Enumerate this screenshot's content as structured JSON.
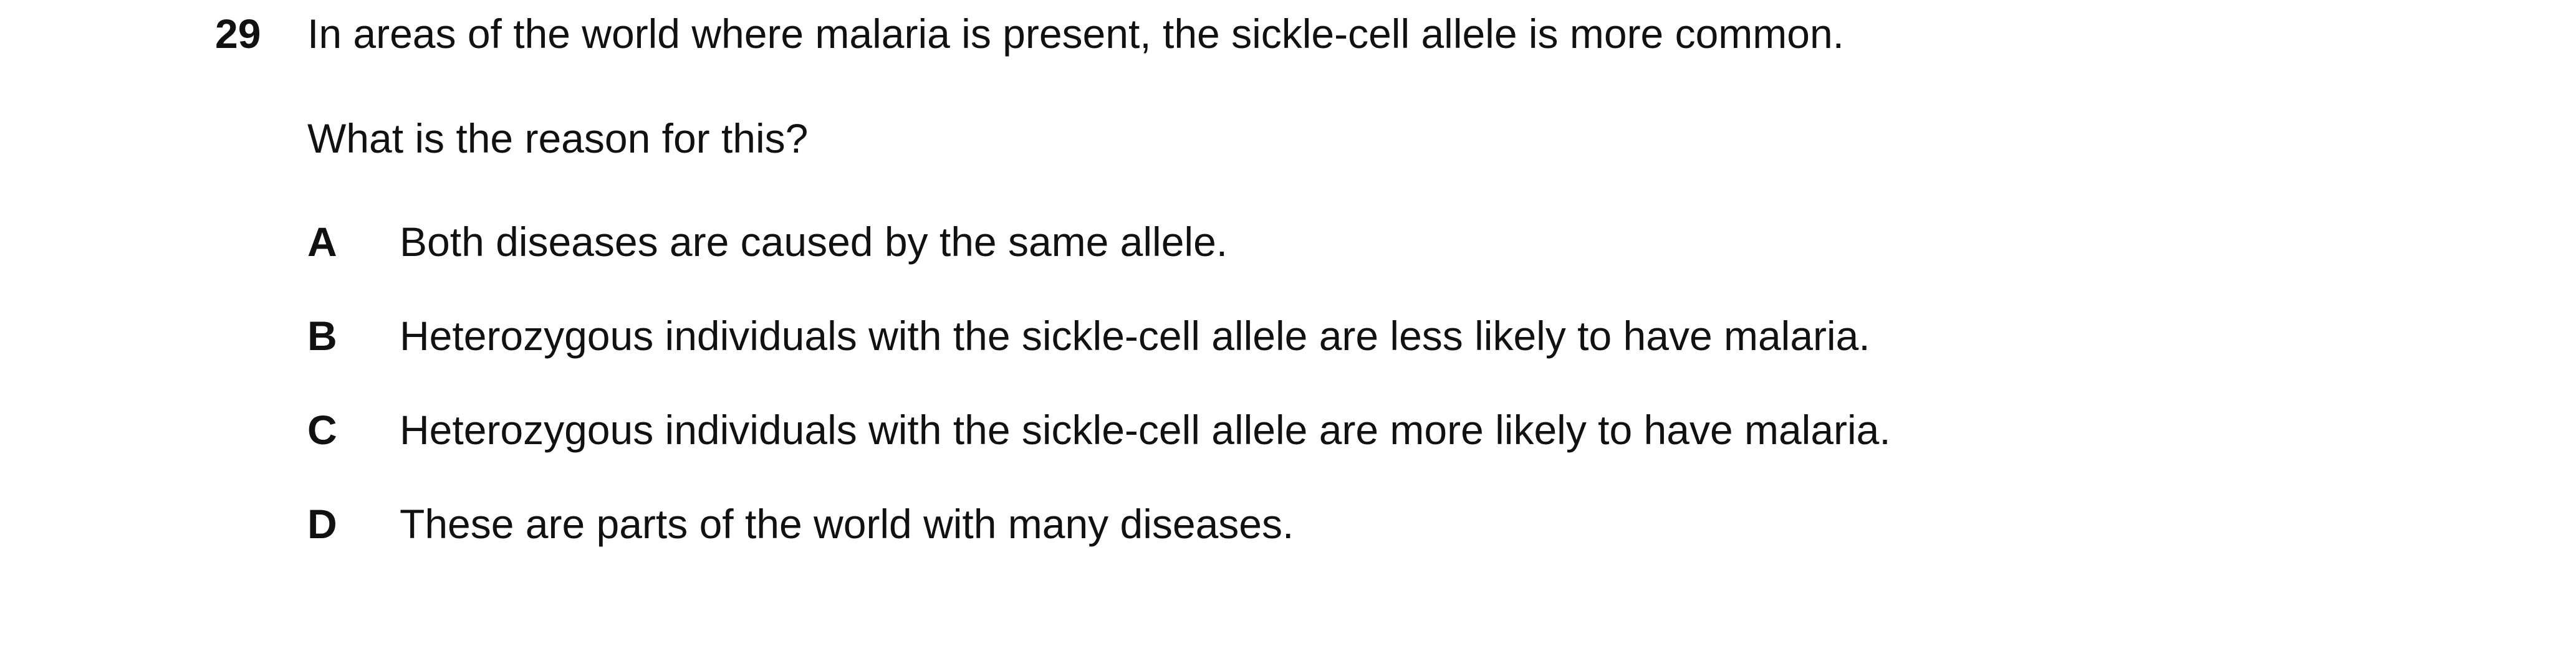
{
  "question": {
    "number": "29",
    "stem": "In areas of the world where malaria is present, the sickle-cell allele is more common.",
    "prompt": "What is the reason for this?",
    "options": [
      {
        "letter": "A",
        "text": "Both diseases are caused by the same allele."
      },
      {
        "letter": "B",
        "text": "Heterozygous individuals with the sickle-cell allele are less likely to have malaria."
      },
      {
        "letter": "C",
        "text": "Heterozygous individuals with the sickle-cell allele are more likely to have malaria."
      },
      {
        "letter": "D",
        "text": "These are parts of the world with many diseases."
      }
    ]
  }
}
